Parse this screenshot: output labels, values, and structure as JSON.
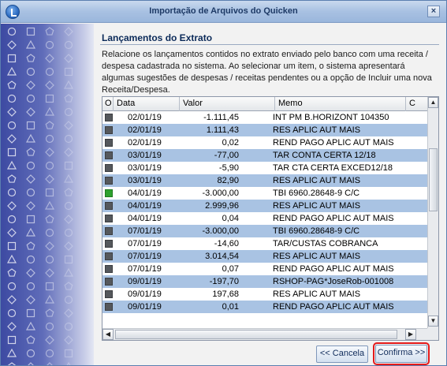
{
  "window": {
    "title": "Importação de Arquivos do Quicken",
    "close_label": "×"
  },
  "section": {
    "title": "Lançamentos do Extrato",
    "description": "Relacione os lançamentos contidos no extrato enviado pelo banco com uma receita / despesa cadastrada no sistema. Ao selecionar um item, o sistema apresentará algumas sugestões de despesas / receitas pendentes ou a opção de Incluir uma nova Receita/Despesa."
  },
  "grid": {
    "columns": [
      "O",
      "Data",
      "Valor",
      "Memo",
      "C"
    ],
    "rows": [
      {
        "checked": false,
        "date": "02/01/19",
        "value": "-1.111,45",
        "memo": "INT PM B.HORIZONT 104350",
        "selected": false
      },
      {
        "checked": false,
        "date": "02/01/19",
        "value": "1.111,43",
        "memo": "RES APLIC AUT MAIS",
        "selected": true
      },
      {
        "checked": false,
        "date": "02/01/19",
        "value": "0,02",
        "memo": "REND PAGO APLIC AUT MAIS",
        "selected": false
      },
      {
        "checked": false,
        "date": "03/01/19",
        "value": "-77,00",
        "memo": "TAR CONTA CERTA    12/18",
        "selected": true
      },
      {
        "checked": false,
        "date": "03/01/19",
        "value": "-5,90",
        "memo": "TAR CTA CERTA EXCED12/18",
        "selected": false
      },
      {
        "checked": false,
        "date": "03/01/19",
        "value": "82,90",
        "memo": "RES APLIC AUT MAIS",
        "selected": true
      },
      {
        "checked": true,
        "date": "04/01/19",
        "value": "-3.000,00",
        "memo": "TBI 6960.28648-9     C/C",
        "selected": false
      },
      {
        "checked": false,
        "date": "04/01/19",
        "value": "2.999,96",
        "memo": "RES APLIC AUT MAIS",
        "selected": true
      },
      {
        "checked": false,
        "date": "04/01/19",
        "value": "0,04",
        "memo": "REND PAGO APLIC AUT MAIS",
        "selected": false
      },
      {
        "checked": false,
        "date": "07/01/19",
        "value": "-3.000,00",
        "memo": "TBI 6960.28648-9     C/C",
        "selected": true
      },
      {
        "checked": false,
        "date": "07/01/19",
        "value": "-14,60",
        "memo": "TAR/CUSTAS COBRANCA",
        "selected": false
      },
      {
        "checked": false,
        "date": "07/01/19",
        "value": "3.014,54",
        "memo": "RES APLIC AUT MAIS",
        "selected": true
      },
      {
        "checked": false,
        "date": "07/01/19",
        "value": "0,07",
        "memo": "REND PAGO APLIC AUT MAIS",
        "selected": false
      },
      {
        "checked": false,
        "date": "09/01/19",
        "value": "-197,70",
        "memo": "RSHOP-PAG*JoseRob-001008",
        "selected": true
      },
      {
        "checked": false,
        "date": "09/01/19",
        "value": "197,68",
        "memo": "RES APLIC AUT MAIS",
        "selected": false
      },
      {
        "checked": false,
        "date": "09/01/19",
        "value": "0,01",
        "memo": "REND PAGO APLIC AUT MAIS",
        "selected": true
      }
    ]
  },
  "buttons": {
    "cancel": "<< Cancela",
    "confirm": "Confirma >>"
  },
  "colors": {
    "selected_row": "#a9c3e3",
    "checked_box": "#2ea12e",
    "highlight_outline": "#e31a1a"
  }
}
